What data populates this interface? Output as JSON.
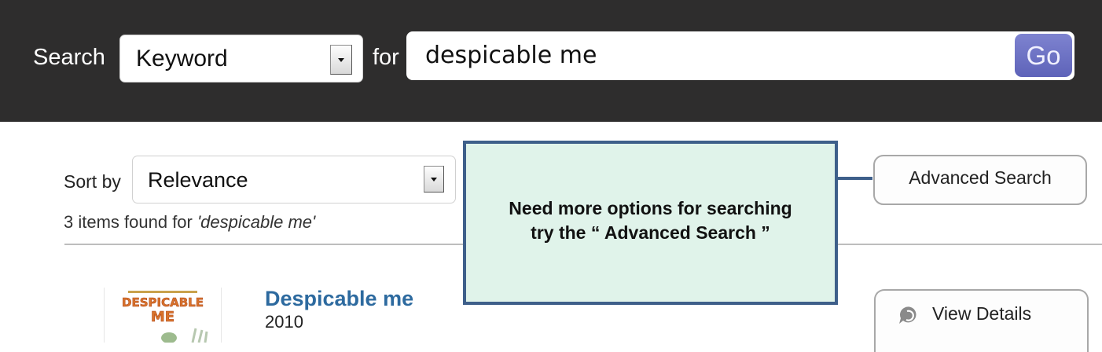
{
  "search_bar": {
    "search_label": "Search",
    "search_type": "Keyword",
    "for_label": "for",
    "query": "despicable me",
    "go_label": "Go"
  },
  "results_header": {
    "sort_label": "Sort by",
    "sort_value": "Relevance",
    "found_prefix": "3 items found for ",
    "found_query": "'despicable me'"
  },
  "advanced_search_label": "Advanced Search",
  "callout": {
    "line1": "Need more options for searching",
    "line2": "try the “ Advanced Search ”"
  },
  "results": [
    {
      "title": "Despicable me",
      "year": "2010",
      "details_label": "View Details",
      "cover_text": "DESPICABLE ME"
    }
  ],
  "colors": {
    "topbar": "#2e2d2d",
    "go_button": "#6a6fc2",
    "link": "#2d6a9f",
    "callout_fill": "#e0f3ea",
    "callout_border": "#3e5f8a"
  },
  "icons": {
    "details": "refresh-chat-icon",
    "dropdown": "chevron-down-icon"
  }
}
